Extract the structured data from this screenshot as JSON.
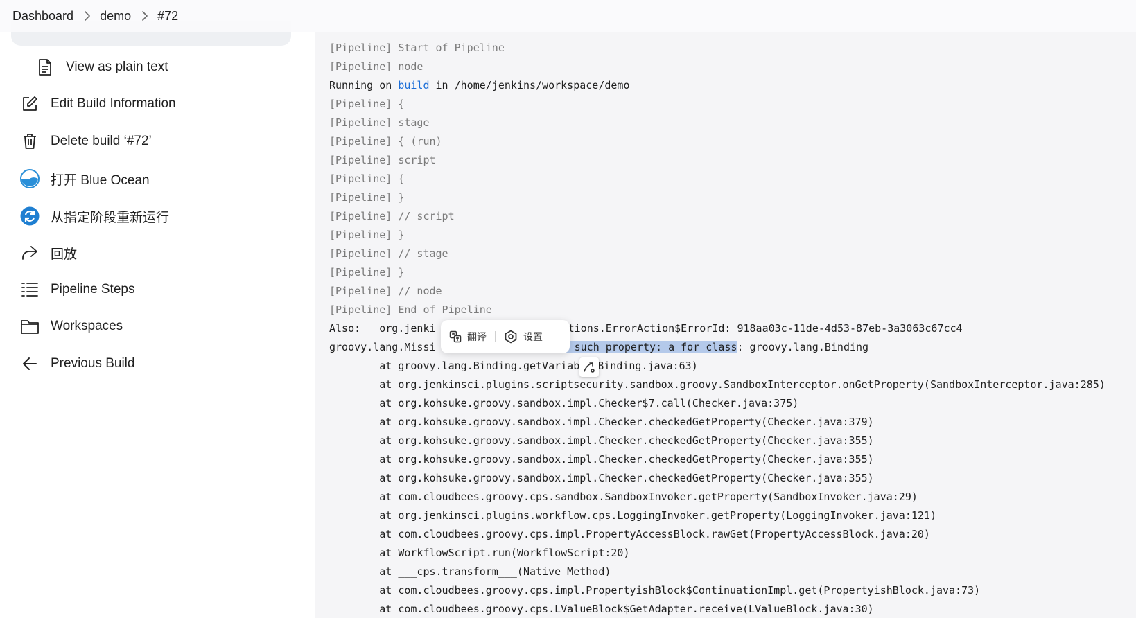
{
  "breadcrumb": {
    "items": [
      "Dashboard",
      "demo",
      "#72"
    ]
  },
  "sidebar": {
    "items": [
      {
        "label": "View as plain text",
        "icon": "document-icon"
      },
      {
        "label": "Edit Build Information",
        "icon": "edit-icon"
      },
      {
        "label": "Delete build ‘#72’",
        "icon": "trash-icon"
      },
      {
        "label": "打开 Blue Ocean",
        "icon": "blue-ocean-icon"
      },
      {
        "label": "从指定阶段重新运行",
        "icon": "restart-stage-icon"
      },
      {
        "label": "回放",
        "icon": "replay-icon"
      },
      {
        "label": "Pipeline Steps",
        "icon": "pipeline-steps-icon"
      },
      {
        "label": "Workspaces",
        "icon": "folder-icon"
      },
      {
        "label": "Previous Build",
        "icon": "arrow-left-icon"
      }
    ]
  },
  "console": {
    "lines": [
      "[Pipeline] Start of Pipeline",
      "[Pipeline] node",
      "Running on ",
      "[Pipeline] {",
      "[Pipeline] stage",
      "[Pipeline] { (run)",
      "[Pipeline] script",
      "[Pipeline] {",
      "[Pipeline] }",
      "[Pipeline] // script",
      "[Pipeline] }",
      "[Pipeline] // stage",
      "[Pipeline] }",
      "[Pipeline] // node",
      "[Pipeline] End of Pipeline",
      "Also:   org.jenki",
      "groovy.lang.Missi",
      "        at groovy.lang.Binding.getVariab",
      "        at org.jenkinsci.plugins.scriptsecurity.sandbox.groovy.SandboxInterceptor.onGetProperty(SandboxInterceptor.java:285)",
      "        at org.kohsuke.groovy.sandbox.impl.Checker$7.call(Checker.java:375)",
      "        at org.kohsuke.groovy.sandbox.impl.Checker.checkedGetProperty(Checker.java:379)",
      "        at org.kohsuke.groovy.sandbox.impl.Checker.checkedGetProperty(Checker.java:355)",
      "        at org.kohsuke.groovy.sandbox.impl.Checker.checkedGetProperty(Checker.java:355)",
      "        at org.kohsuke.groovy.sandbox.impl.Checker.checkedGetProperty(Checker.java:355)",
      "        at com.cloudbees.groovy.cps.sandbox.SandboxInvoker.getProperty(SandboxInvoker.java:29)",
      "        at org.jenkinsci.plugins.workflow.cps.LoggingInvoker.getProperty(LoggingInvoker.java:121)",
      "        at com.cloudbees.groovy.cps.impl.PropertyAccessBlock.rawGet(PropertyAccessBlock.java:20)",
      "        at WorkflowScript.run(WorkflowScript:20)",
      "        at ___cps.transform___(Native Method)",
      "        at com.cloudbees.groovy.cps.impl.PropertyishBlock$ContinuationImpl.get(PropertyishBlock.java:73)",
      "        at com.cloudbees.groovy.cps.LValueBlock$GetAdapter.receive(LValueBlock.java:30)"
    ],
    "running_link": "build",
    "running_suffix": " in /home/jenkins/workspace/demo",
    "also_suffix": ".actions.ErrorAction$ErrorId: 918aa03c-11de-4d53-87eb-3a3063c67cc4",
    "selected_text": "No such property: a for class",
    "missing_suffix": ": groovy.lang.Binding",
    "binding_suffix": "Binding.java:63)"
  },
  "popup": {
    "translate_label": "翻译",
    "settings_label": "设置"
  },
  "colors": {
    "link": "#1d6fd8",
    "selection": "#b4c9ea",
    "blue_ocean": "#2a8fd8"
  }
}
